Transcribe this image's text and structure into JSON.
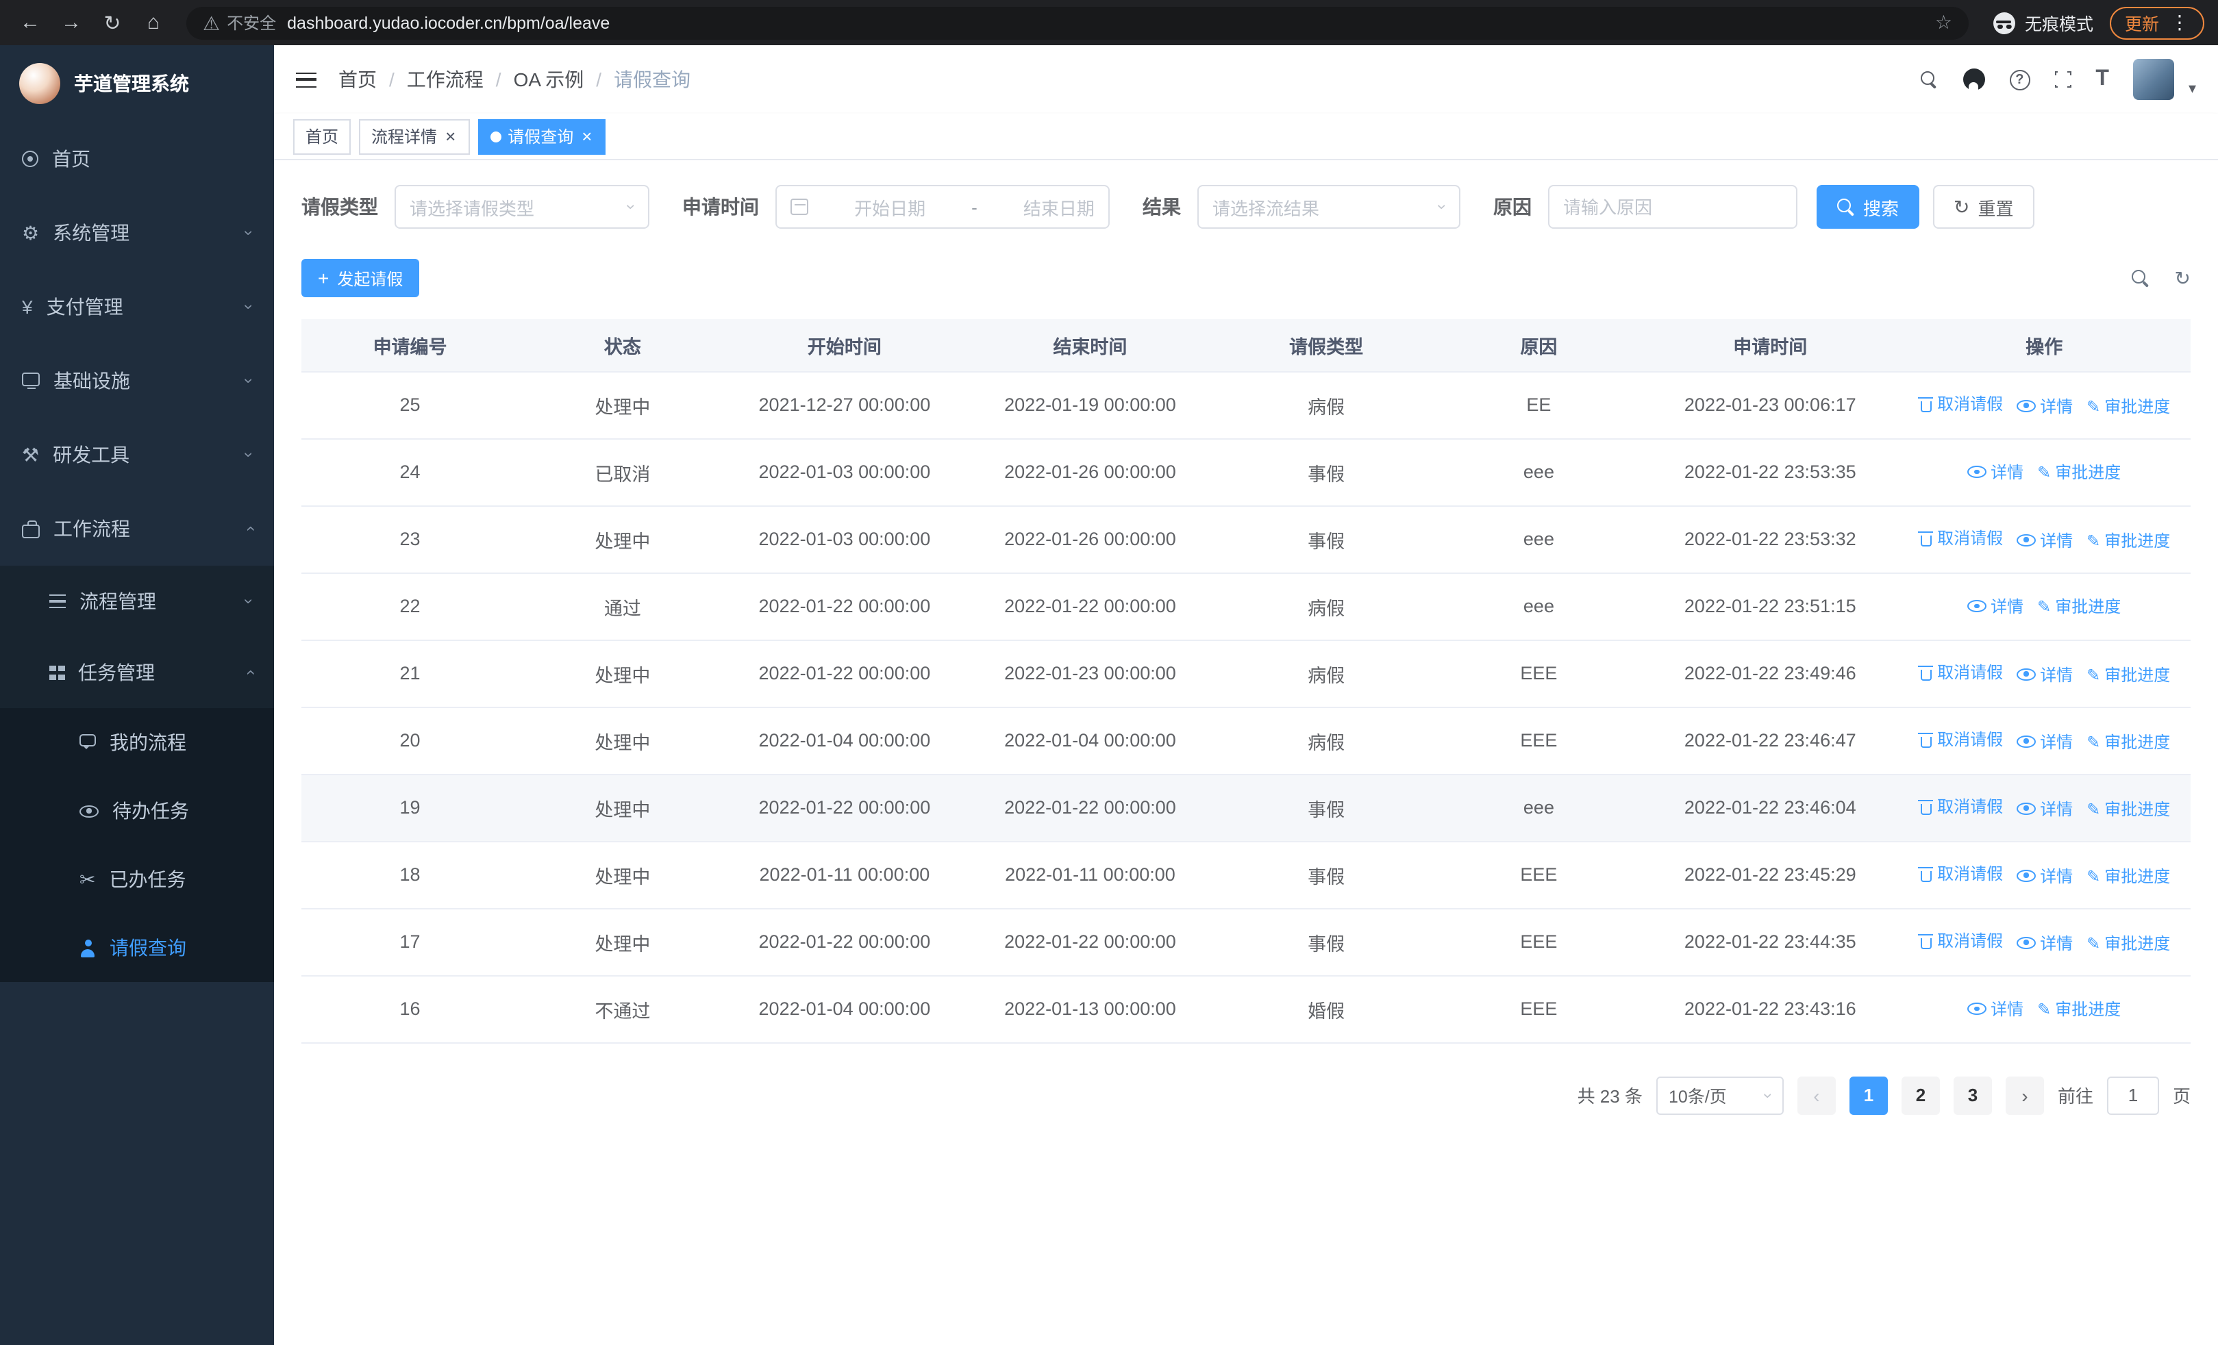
{
  "colors": {
    "accent": "#409eff",
    "sidebar_bg": "#1f2d3d",
    "update_orange": "#f0883e"
  },
  "browser": {
    "security_warning": "不安全",
    "url": "dashboard.yudao.iocoder.cn/bpm/oa/leave",
    "incognito_label": "无痕模式",
    "update_label": "更新"
  },
  "sidebar": {
    "logo_title": "芋道管理系统",
    "menu": [
      {
        "name": "home",
        "label": "首页",
        "icon": "dash",
        "level": 1
      },
      {
        "name": "system-mgmt",
        "label": "系统管理",
        "icon": "gear",
        "level": 1,
        "chevron": "down"
      },
      {
        "name": "payment-mgmt",
        "label": "支付管理",
        "icon": "yen",
        "level": 1,
        "chevron": "down"
      },
      {
        "name": "infrastructure",
        "label": "基础设施",
        "icon": "mon",
        "level": 1,
        "chevron": "down"
      },
      {
        "name": "dev-tools",
        "label": "研发工具",
        "icon": "tools",
        "level": 1,
        "chevron": "down"
      },
      {
        "name": "workflow",
        "label": "工作流程",
        "icon": "brief",
        "level": 1,
        "chevron": "up"
      },
      {
        "name": "process-mgmt",
        "label": "流程管理",
        "icon": "list",
        "level": 2,
        "chevron": "down"
      },
      {
        "name": "task-mgmt",
        "label": "任务管理",
        "icon": "grid",
        "level": 2,
        "chevron": "up"
      },
      {
        "name": "my-process",
        "label": "我的流程",
        "icon": "chat",
        "level": 3
      },
      {
        "name": "todo-tasks",
        "label": "待办任务",
        "icon": "eye",
        "level": 3
      },
      {
        "name": "done-tasks",
        "label": "已办任务",
        "icon": "scissors",
        "level": 3
      },
      {
        "name": "leave-query",
        "label": "请假查询",
        "icon": "user",
        "level": 3,
        "active": true
      }
    ]
  },
  "header": {
    "breadcrumb": [
      "首页",
      "工作流程",
      "OA 示例",
      "请假查询"
    ],
    "separator": "/"
  },
  "tags_view": [
    {
      "label": "首页",
      "closable": false,
      "active": false
    },
    {
      "label": "流程详情",
      "closable": true,
      "active": false
    },
    {
      "label": "请假查询",
      "closable": true,
      "active": true
    }
  ],
  "filters": {
    "type_label": "请假类型",
    "type_placeholder": "请选择请假类型",
    "time_label": "申请时间",
    "start_placeholder": "开始日期",
    "range_separator": "-",
    "end_placeholder": "结束日期",
    "result_label": "结果",
    "result_placeholder": "请选择流结果",
    "reason_label": "原因",
    "reason_placeholder": "请输入原因",
    "search_label": "搜索",
    "reset_label": "重置"
  },
  "toolbar": {
    "create_label": "发起请假"
  },
  "table": {
    "columns": [
      {
        "key": "id",
        "label": "申请编号"
      },
      {
        "key": "status",
        "label": "状态"
      },
      {
        "key": "start",
        "label": "开始时间"
      },
      {
        "key": "end",
        "label": "结束时间"
      },
      {
        "key": "type",
        "label": "请假类型"
      },
      {
        "key": "reason",
        "label": "原因"
      },
      {
        "key": "applyTime",
        "label": "申请时间"
      },
      {
        "key": "ops",
        "label": "操作"
      }
    ],
    "actions": {
      "cancel": "取消请假",
      "detail": "详情",
      "progress": "审批进度"
    },
    "rows": [
      {
        "id": "25",
        "status": "处理中",
        "start": "2021-12-27 00:00:00",
        "end": "2022-01-19 00:00:00",
        "type": "病假",
        "reason": "EE",
        "applyTime": "2022-01-23 00:06:17",
        "cancelable": true
      },
      {
        "id": "24",
        "status": "已取消",
        "start": "2022-01-03 00:00:00",
        "end": "2022-01-26 00:00:00",
        "type": "事假",
        "reason": "eee",
        "applyTime": "2022-01-22 23:53:35",
        "cancelable": false
      },
      {
        "id": "23",
        "status": "处理中",
        "start": "2022-01-03 00:00:00",
        "end": "2022-01-26 00:00:00",
        "type": "事假",
        "reason": "eee",
        "applyTime": "2022-01-22 23:53:32",
        "cancelable": true
      },
      {
        "id": "22",
        "status": "通过",
        "start": "2022-01-22 00:00:00",
        "end": "2022-01-22 00:00:00",
        "type": "病假",
        "reason": "eee",
        "applyTime": "2022-01-22 23:51:15",
        "cancelable": false
      },
      {
        "id": "21",
        "status": "处理中",
        "start": "2022-01-22 00:00:00",
        "end": "2022-01-23 00:00:00",
        "type": "病假",
        "reason": "EEE",
        "applyTime": "2022-01-22 23:49:46",
        "cancelable": true
      },
      {
        "id": "20",
        "status": "处理中",
        "start": "2022-01-04 00:00:00",
        "end": "2022-01-04 00:00:00",
        "type": "病假",
        "reason": "EEE",
        "applyTime": "2022-01-22 23:46:47",
        "cancelable": true
      },
      {
        "id": "19",
        "status": "处理中",
        "start": "2022-01-22 00:00:00",
        "end": "2022-01-22 00:00:00",
        "type": "事假",
        "reason": "eee",
        "applyTime": "2022-01-22 23:46:04",
        "cancelable": true,
        "hovered": true
      },
      {
        "id": "18",
        "status": "处理中",
        "start": "2022-01-11 00:00:00",
        "end": "2022-01-11 00:00:00",
        "type": "事假",
        "reason": "EEE",
        "applyTime": "2022-01-22 23:45:29",
        "cancelable": true
      },
      {
        "id": "17",
        "status": "处理中",
        "start": "2022-01-22 00:00:00",
        "end": "2022-01-22 00:00:00",
        "type": "事假",
        "reason": "EEE",
        "applyTime": "2022-01-22 23:44:35",
        "cancelable": true
      },
      {
        "id": "16",
        "status": "不通过",
        "start": "2022-01-04 00:00:00",
        "end": "2022-01-13 00:00:00",
        "type": "婚假",
        "reason": "EEE",
        "applyTime": "2022-01-22 23:43:16",
        "cancelable": false
      }
    ]
  },
  "pagination": {
    "total_text": "共 23 条",
    "page_size": "10条/页",
    "pages": [
      "1",
      "2",
      "3"
    ],
    "active_page": "1",
    "goto_label": "前往",
    "goto_value": "1",
    "goto_suffix": "页"
  }
}
